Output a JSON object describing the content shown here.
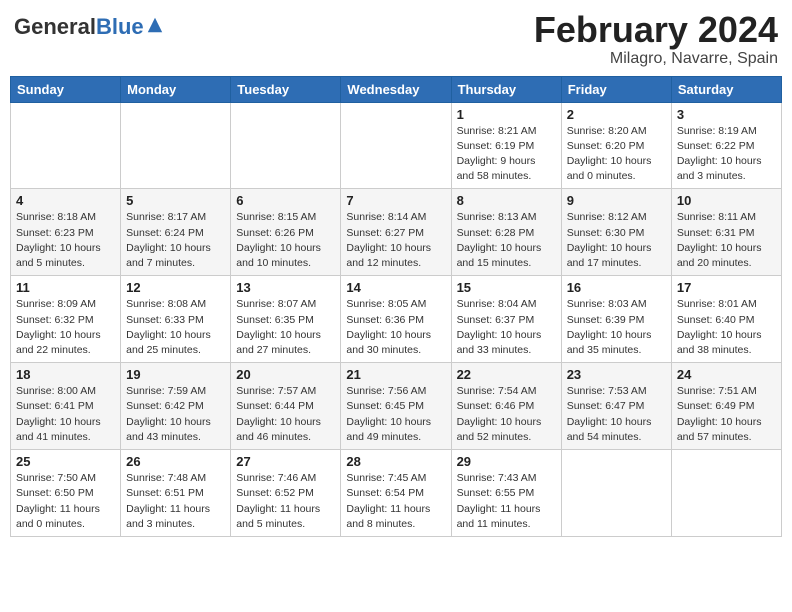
{
  "header": {
    "logo": {
      "general": "General",
      "blue": "Blue"
    },
    "title": "February 2024",
    "location": "Milagro, Navarre, Spain"
  },
  "weekdays": [
    "Sunday",
    "Monday",
    "Tuesday",
    "Wednesday",
    "Thursday",
    "Friday",
    "Saturday"
  ],
  "weeks": [
    [
      {
        "day": "",
        "info": ""
      },
      {
        "day": "",
        "info": ""
      },
      {
        "day": "",
        "info": ""
      },
      {
        "day": "",
        "info": ""
      },
      {
        "day": "1",
        "info": "Sunrise: 8:21 AM\nSunset: 6:19 PM\nDaylight: 9 hours\nand 58 minutes."
      },
      {
        "day": "2",
        "info": "Sunrise: 8:20 AM\nSunset: 6:20 PM\nDaylight: 10 hours\nand 0 minutes."
      },
      {
        "day": "3",
        "info": "Sunrise: 8:19 AM\nSunset: 6:22 PM\nDaylight: 10 hours\nand 3 minutes."
      }
    ],
    [
      {
        "day": "4",
        "info": "Sunrise: 8:18 AM\nSunset: 6:23 PM\nDaylight: 10 hours\nand 5 minutes."
      },
      {
        "day": "5",
        "info": "Sunrise: 8:17 AM\nSunset: 6:24 PM\nDaylight: 10 hours\nand 7 minutes."
      },
      {
        "day": "6",
        "info": "Sunrise: 8:15 AM\nSunset: 6:26 PM\nDaylight: 10 hours\nand 10 minutes."
      },
      {
        "day": "7",
        "info": "Sunrise: 8:14 AM\nSunset: 6:27 PM\nDaylight: 10 hours\nand 12 minutes."
      },
      {
        "day": "8",
        "info": "Sunrise: 8:13 AM\nSunset: 6:28 PM\nDaylight: 10 hours\nand 15 minutes."
      },
      {
        "day": "9",
        "info": "Sunrise: 8:12 AM\nSunset: 6:30 PM\nDaylight: 10 hours\nand 17 minutes."
      },
      {
        "day": "10",
        "info": "Sunrise: 8:11 AM\nSunset: 6:31 PM\nDaylight: 10 hours\nand 20 minutes."
      }
    ],
    [
      {
        "day": "11",
        "info": "Sunrise: 8:09 AM\nSunset: 6:32 PM\nDaylight: 10 hours\nand 22 minutes."
      },
      {
        "day": "12",
        "info": "Sunrise: 8:08 AM\nSunset: 6:33 PM\nDaylight: 10 hours\nand 25 minutes."
      },
      {
        "day": "13",
        "info": "Sunrise: 8:07 AM\nSunset: 6:35 PM\nDaylight: 10 hours\nand 27 minutes."
      },
      {
        "day": "14",
        "info": "Sunrise: 8:05 AM\nSunset: 6:36 PM\nDaylight: 10 hours\nand 30 minutes."
      },
      {
        "day": "15",
        "info": "Sunrise: 8:04 AM\nSunset: 6:37 PM\nDaylight: 10 hours\nand 33 minutes."
      },
      {
        "day": "16",
        "info": "Sunrise: 8:03 AM\nSunset: 6:39 PM\nDaylight: 10 hours\nand 35 minutes."
      },
      {
        "day": "17",
        "info": "Sunrise: 8:01 AM\nSunset: 6:40 PM\nDaylight: 10 hours\nand 38 minutes."
      }
    ],
    [
      {
        "day": "18",
        "info": "Sunrise: 8:00 AM\nSunset: 6:41 PM\nDaylight: 10 hours\nand 41 minutes."
      },
      {
        "day": "19",
        "info": "Sunrise: 7:59 AM\nSunset: 6:42 PM\nDaylight: 10 hours\nand 43 minutes."
      },
      {
        "day": "20",
        "info": "Sunrise: 7:57 AM\nSunset: 6:44 PM\nDaylight: 10 hours\nand 46 minutes."
      },
      {
        "day": "21",
        "info": "Sunrise: 7:56 AM\nSunset: 6:45 PM\nDaylight: 10 hours\nand 49 minutes."
      },
      {
        "day": "22",
        "info": "Sunrise: 7:54 AM\nSunset: 6:46 PM\nDaylight: 10 hours\nand 52 minutes."
      },
      {
        "day": "23",
        "info": "Sunrise: 7:53 AM\nSunset: 6:47 PM\nDaylight: 10 hours\nand 54 minutes."
      },
      {
        "day": "24",
        "info": "Sunrise: 7:51 AM\nSunset: 6:49 PM\nDaylight: 10 hours\nand 57 minutes."
      }
    ],
    [
      {
        "day": "25",
        "info": "Sunrise: 7:50 AM\nSunset: 6:50 PM\nDaylight: 11 hours\nand 0 minutes."
      },
      {
        "day": "26",
        "info": "Sunrise: 7:48 AM\nSunset: 6:51 PM\nDaylight: 11 hours\nand 3 minutes."
      },
      {
        "day": "27",
        "info": "Sunrise: 7:46 AM\nSunset: 6:52 PM\nDaylight: 11 hours\nand 5 minutes."
      },
      {
        "day": "28",
        "info": "Sunrise: 7:45 AM\nSunset: 6:54 PM\nDaylight: 11 hours\nand 8 minutes."
      },
      {
        "day": "29",
        "info": "Sunrise: 7:43 AM\nSunset: 6:55 PM\nDaylight: 11 hours\nand 11 minutes."
      },
      {
        "day": "",
        "info": ""
      },
      {
        "day": "",
        "info": ""
      }
    ]
  ]
}
